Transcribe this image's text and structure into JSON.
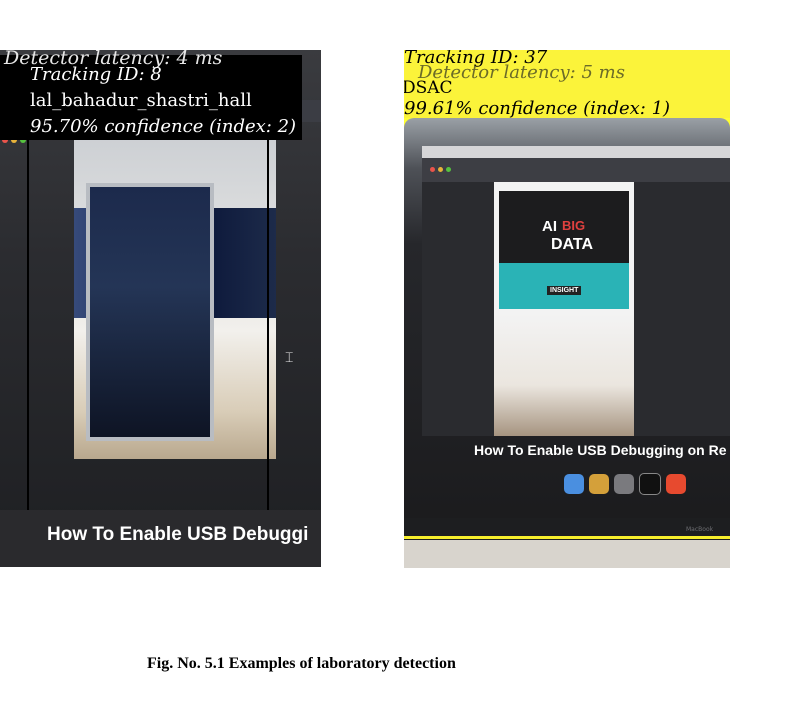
{
  "left_image": {
    "overlay": {
      "detector_latency": "Detector latency: 4 ms",
      "tracking_id": "Tracking ID: 8",
      "label": "lal_bahadur_shastri_hall",
      "confidence": "95.70% confidence (index: 2)"
    },
    "screen_caption": "How To Enable USB Debuggi",
    "colors": {
      "overlay_text": "#ffffff",
      "overlay_bg": "#000000",
      "bbox": "#000000"
    }
  },
  "right_image": {
    "overlay": {
      "tracking_id": "Tracking ID: 37",
      "detector_latency": "Detector latency: 5 ms",
      "label": "DSAC",
      "confidence": "99.61% confidence (index: 1)"
    },
    "screen_caption": "How To Enable USB Debugging on Re",
    "poster": {
      "big": "BIG",
      "data": "DATA",
      "insight": "INSIGHT",
      "ai": "AI"
    },
    "laptop_brand": "MacBook",
    "colors": {
      "overlay_text": "#000000",
      "overlay_bg": "#fbf33a",
      "bbox": "#f7ef2c"
    }
  },
  "figure_caption": "Fig. No. 5.1 Examples of laboratory detection"
}
